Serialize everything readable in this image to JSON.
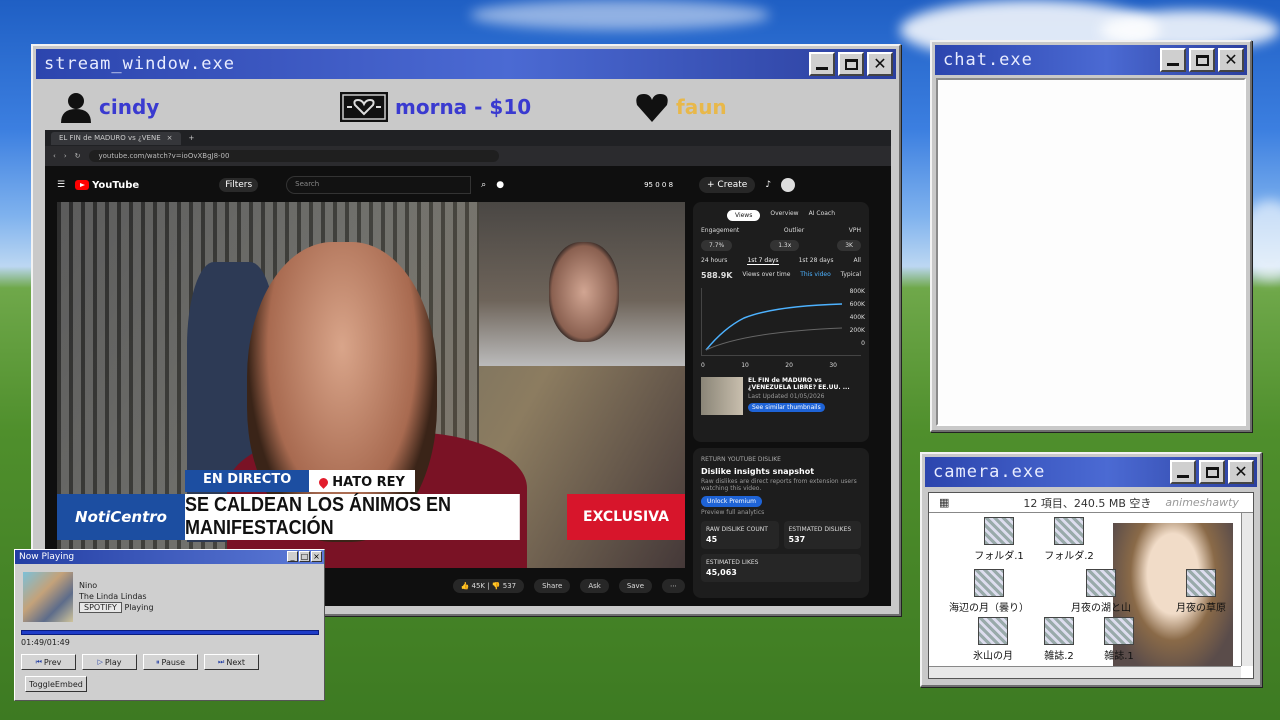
{
  "stream_window": {
    "title": "stream_window.exe",
    "donors": [
      {
        "name": "cindy",
        "icon": "user-icon",
        "color": "#3a3ad0"
      },
      {
        "name": "morna - $10",
        "icon": "heart-badge-icon",
        "color": "#3a3ad0"
      },
      {
        "name": "faun",
        "icon": "heart-icon",
        "color": "#e8b84a"
      }
    ],
    "browser": {
      "tab_title": "EL FIN de MADURO vs ¿VENE",
      "url": "youtube.com/watch?v=ioOvXBgJ8-00",
      "search_placeholder": "Search",
      "filters_label": "Filters",
      "create_label": "+ Create",
      "stats": "95 0 0 8"
    },
    "video": {
      "tag_live": "EN DIRECTO",
      "tag_location": "HATO REY",
      "brand": "NotiCentro",
      "headline": "SE CALDEAN LOS ÁNIMOS EN MANIFESTACIÓN",
      "exclusive": "EXCLUSIVA"
    },
    "actions": {
      "likes": "45K",
      "dislikes": "537",
      "share": "Share",
      "ask": "Ask",
      "save": "Save"
    },
    "insights": {
      "tabs": [
        "Views",
        "Overview",
        "AI Coach"
      ],
      "engagement_label": "Engagement",
      "engagement": "7.7%",
      "outlier_label": "Outlier",
      "outlier": "1.3x",
      "vph_label": "VPH",
      "vph": "3K",
      "ranges": [
        "24 hours",
        "1st 7 days",
        "1st 28 days",
        "All"
      ],
      "views": "588.9K",
      "views_dropdown": "Views over time",
      "legend_this": "This video",
      "legend_typical": "Typical",
      "y_ticks": [
        "800K",
        "600K",
        "400K",
        "200K",
        "0"
      ],
      "x_ticks": [
        "0",
        "10",
        "20",
        "30"
      ],
      "video_title": "EL FIN de MADURO vs ¿VENEZUELA LIBRE? EE.UU. ...",
      "last_updated": "Last Updated 01/05/2026",
      "similar": "See similar thumbnails"
    },
    "dislike": {
      "header": "RETURN YOUTUBE DISLIKE",
      "title": "Dislike insights snapshot",
      "desc": "Raw dislikes are direct reports from extension users watching this video.",
      "unlock": "Unlock Premium",
      "preview": "Preview full analytics",
      "raw_label": "RAW DISLIKE COUNT",
      "raw": "45",
      "est_dis_label": "ESTIMATED DISLIKES",
      "est_dis": "537",
      "est_likes_label": "ESTIMATED LIKES",
      "est_likes": "45,063"
    }
  },
  "chat": {
    "title": "chat.exe"
  },
  "camera": {
    "title": "camera.exe",
    "status": "12 項目、240.5 MB 空き",
    "watermark": "animeshawty",
    "items": [
      "フォルダ.1",
      "フォルダ.2",
      "海辺の月（曇り）",
      "月夜の湖と山",
      "月夜の草原",
      "氷山の月",
      "雑誌.2",
      "雑誌.1"
    ]
  },
  "now_playing": {
    "title": "Now Playing",
    "track": "Nino",
    "artist": "The Linda Lindas",
    "source": "SPOTIFY",
    "state": "Playing",
    "time": "01:49/01:49",
    "progress": 1.0,
    "buttons": [
      "Prev",
      "Play",
      "Pause",
      "Next"
    ],
    "toggle": "ToggleEmbed"
  }
}
